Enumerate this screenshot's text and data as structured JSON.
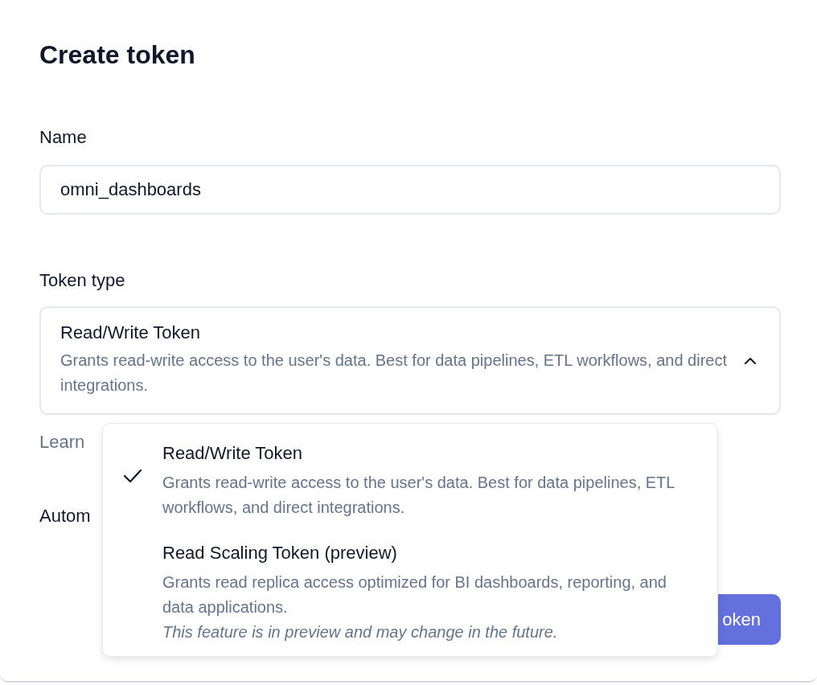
{
  "dialog": {
    "title": "Create token",
    "name_field": {
      "label": "Name",
      "value": "omni_dashboards"
    },
    "token_type": {
      "label": "Token type",
      "value": "Read/Write Token",
      "description": "Grants read-write access to the user's data. Best for data pipelines, ETL workflows, and direct integrations.",
      "expanded": true
    },
    "learn_text": "Learn",
    "automation_label": "Autom",
    "submit_button": "oken",
    "dropdown": {
      "options": [
        {
          "title": "Read/Write Token",
          "description": "Grants read-write access to the user's data. Best for data pipelines, ETL workflows, and direct integrations.",
          "selected": true
        },
        {
          "title": "Read Scaling Token (preview)",
          "description": "Grants read replica access optimized for BI dashboards, reporting, and data applications.",
          "note": "This feature is in preview and may change in the future.",
          "selected": false
        }
      ]
    }
  }
}
